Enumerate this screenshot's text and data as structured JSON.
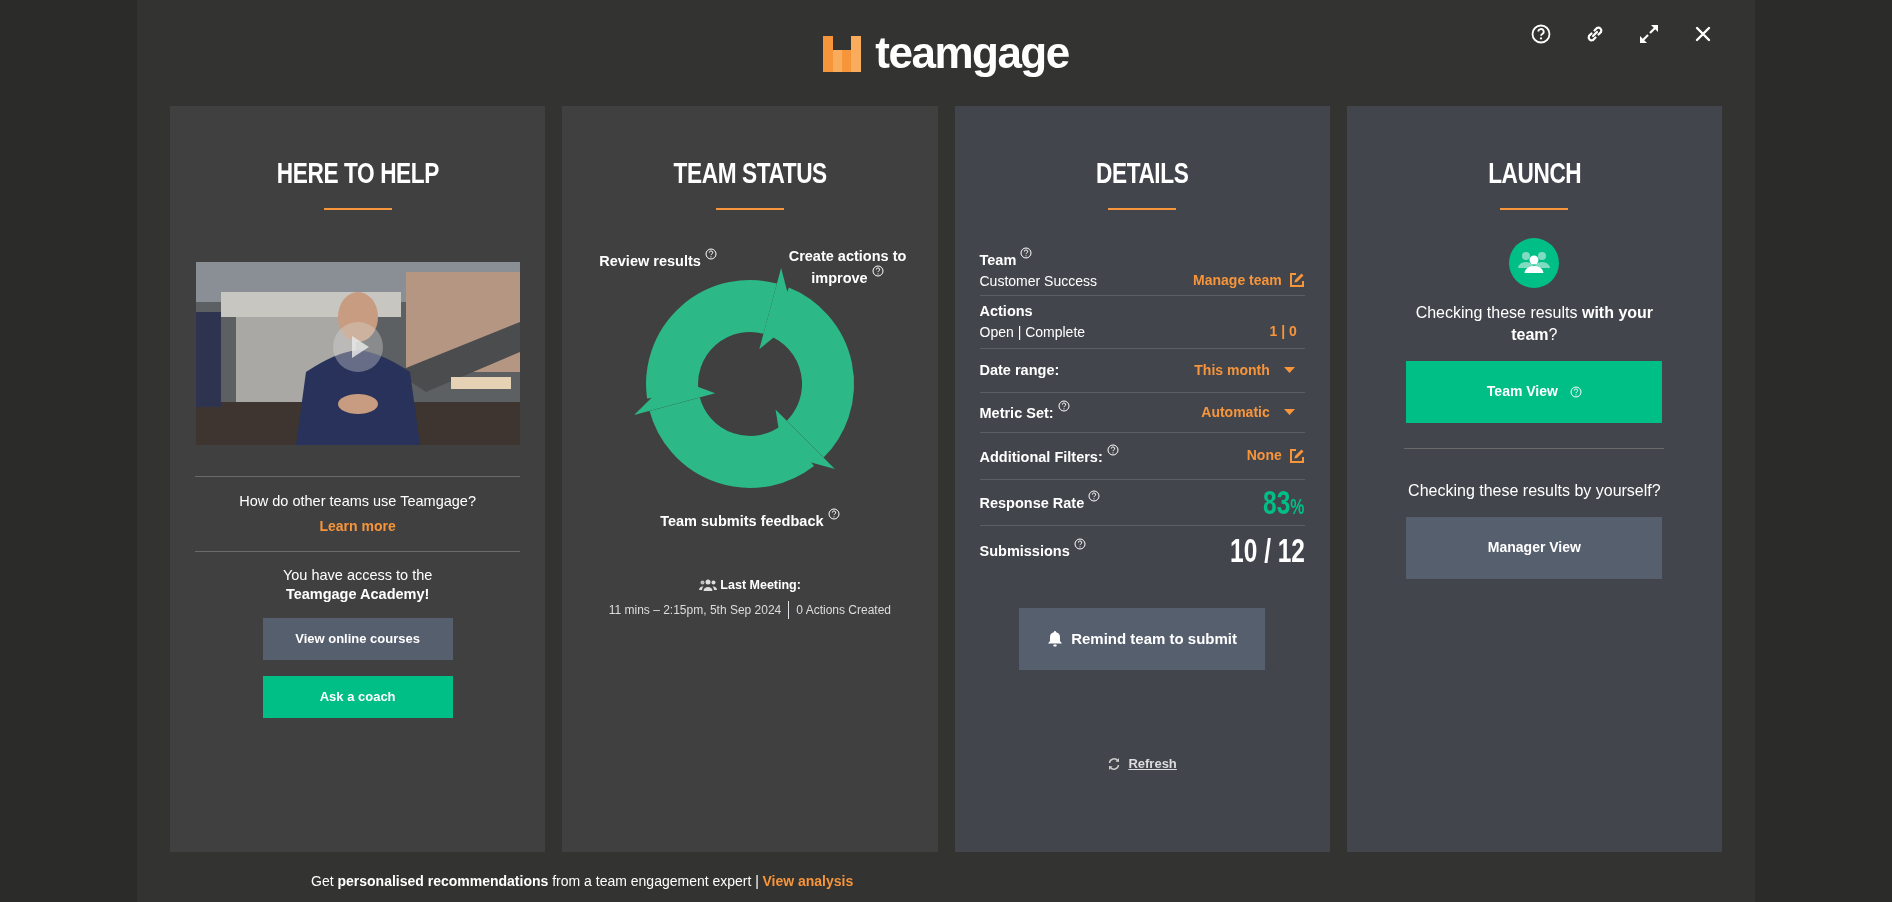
{
  "header": {
    "logo_text": "teamgage"
  },
  "help_panel": {
    "title": "HERE TO HELP",
    "question": "How do other teams use Teamgage?",
    "link": "Learn more",
    "academy": "You have access to the **Teamgage Academy!**",
    "buttons": [
      {
        "label": "View online courses",
        "kind": "secondary"
      },
      {
        "label": "Ask a coach",
        "kind": "primary"
      }
    ]
  },
  "status_panel": {
    "title": "TEAM STATUS",
    "cycle_labels": [
      {
        "label": "Review results",
        "help": true
      },
      {
        "label": "Create actions to improve",
        "help": true
      },
      {
        "label": "Team submits feedback",
        "help": true
      }
    ],
    "last_meeting_label": "Last Meeting:",
    "last_meeting_time": "11 mins – 2:15pm, 5th Sep 2024",
    "actions_created": "0 Actions Created"
  },
  "details_panel": {
    "title": "DETAILS",
    "rows": [
      {
        "label": "Team",
        "sublabel": "Customer Success",
        "help": true,
        "value": "Manage team",
        "kind": "edit"
      },
      {
        "label": "Actions",
        "sublabel": "Open | Complete",
        "help": false,
        "value": "1 | 0",
        "kind": "count"
      },
      {
        "label": "Date range:",
        "help": false,
        "value": "This month",
        "kind": "dropdown"
      },
      {
        "label": "Metric Set:",
        "help": true,
        "value": "Automatic",
        "kind": "dropdown"
      },
      {
        "label": "Additional Filters:",
        "help": true,
        "value": "None",
        "kind": "edit"
      },
      {
        "label": "Response Rate",
        "help": true,
        "value": "83",
        "unit": "%",
        "kind": "percent"
      },
      {
        "label": "Submissions",
        "help": true,
        "value": "10 / 12",
        "kind": "big"
      }
    ],
    "remind_button": "Remind team to submit",
    "refresh": "Refresh"
  },
  "launch_panel": {
    "title": "LAUNCH",
    "team_prompt": "Checking these results **with your team**?",
    "team_button": {
      "label": "Team View",
      "help": true
    },
    "solo_prompt": "Checking these results by yourself?",
    "manager_button": {
      "label": "Manager View",
      "help": false
    }
  },
  "footer": {
    "text": "Get **personalised recommendations** from a team engagement expert |",
    "link": "View analysis"
  }
}
